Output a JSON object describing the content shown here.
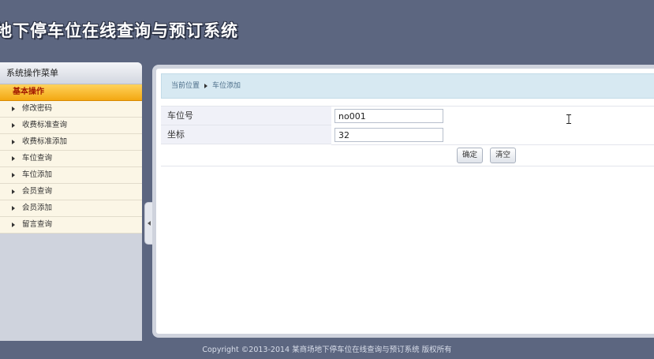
{
  "header": {
    "title": "地下停车位在线查询与预订系统"
  },
  "sidebar": {
    "title": "系统操作菜单",
    "group": "基本操作",
    "items": [
      {
        "label": "修改密码"
      },
      {
        "label": "收费标准查询"
      },
      {
        "label": "收费标准添加"
      },
      {
        "label": "车位查询"
      },
      {
        "label": "车位添加"
      },
      {
        "label": "会员查询"
      },
      {
        "label": "会员添加"
      },
      {
        "label": "留言查询"
      }
    ]
  },
  "breadcrumb": {
    "prefix": "当前位置",
    "current": "车位添加"
  },
  "form": {
    "fields": [
      {
        "label": "车位号",
        "value": "no001"
      },
      {
        "label": "坐标",
        "value": "32"
      }
    ],
    "submit_label": "确定",
    "reset_label": "清空"
  },
  "footer": {
    "copyright": "Copyright ©2013-2014 某商场地下停车位在线查询与预订系统 版权所有"
  }
}
